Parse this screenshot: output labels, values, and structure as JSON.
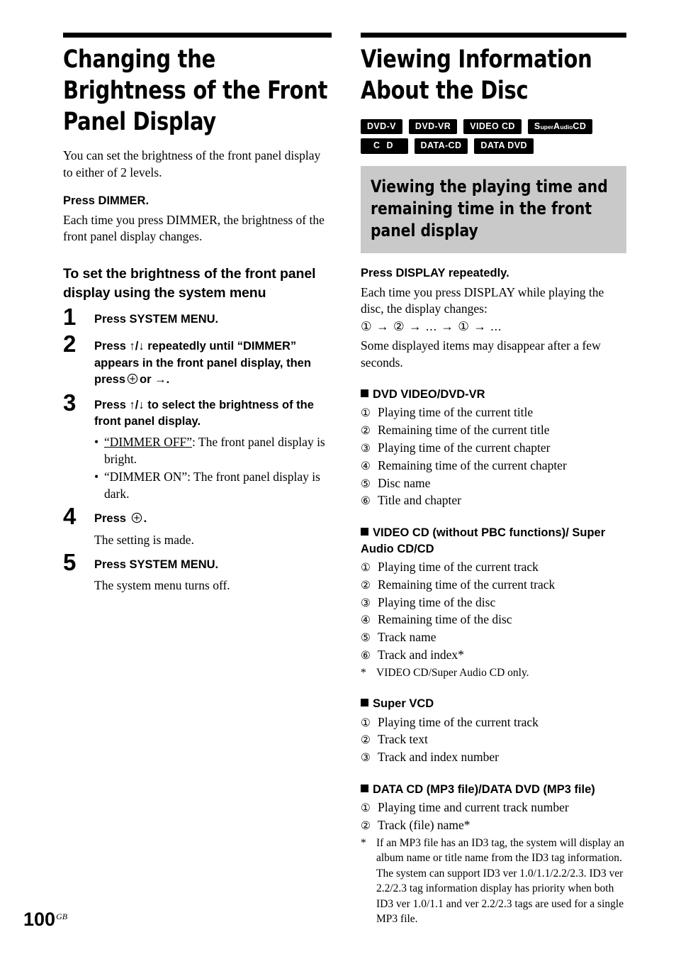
{
  "page": {
    "number": "100",
    "number_suffix": "GB"
  },
  "left_column": {
    "title": "Changing the Brightness of the Front Panel Display",
    "intro": "You can set the brightness of the front panel display to either of 2 levels.",
    "press_dimmer_head": "Press DIMMER.",
    "press_dimmer_body": "Each time you press DIMMER, the brightness of the front panel display changes.",
    "sub_head": "To set the brightness of the front panel display using the system menu",
    "steps": [
      {
        "number": "1",
        "text": "Press SYSTEM MENU."
      },
      {
        "number": "2",
        "text_before_icon": "Press ↑/↓ repeatedly until “DIMMER” appears in the front panel display, then press",
        "icon": "enter-button-icon",
        "text_after_icon": "or →."
      },
      {
        "number": "3",
        "text": "Press ↑/↓ to select the brightness of the front panel display.",
        "bullets": [
          {
            "quoted": "“DIMMER OFF”",
            "underlined": true,
            "rest": ": The front panel display is bright."
          },
          {
            "quoted": "“DIMMER ON”",
            "underlined": false,
            "rest": ": The front panel display is dark."
          }
        ]
      },
      {
        "number": "4",
        "text_before_icon": "Press",
        "icon": "enter-button-icon",
        "text_after_icon": ".",
        "note": "The setting is made."
      },
      {
        "number": "5",
        "text": "Press SYSTEM MENU.",
        "note": "The system menu turns off."
      }
    ]
  },
  "right_column": {
    "title": "Viewing Information About the Disc",
    "badges": [
      {
        "label": "DVD-V",
        "kind": "plain"
      },
      {
        "label": "DVD-VR",
        "kind": "plain"
      },
      {
        "label": "VIDEO CD",
        "kind": "plain"
      },
      {
        "label": "SuperAudioCD",
        "kind": "sacd"
      },
      {
        "label": "C D",
        "kind": "wide"
      },
      {
        "label": "DATA-CD",
        "kind": "plain"
      },
      {
        "label": "DATA DVD",
        "kind": "plain"
      }
    ],
    "gray_heading": "Viewing the playing time and remaining time in the front panel display",
    "press_display_head": "Press DISPLAY repeatedly.",
    "press_display_body": "Each time you press DISPLAY while playing the disc, the display changes:",
    "sequence": "① → ② → ... → ① → ...",
    "sequence_note": "Some displayed items may disappear after a few seconds.",
    "sections": [
      {
        "heading": "DVD VIDEO/DVD-VR",
        "items": [
          {
            "num": "①",
            "text": "Playing time of the current title"
          },
          {
            "num": "②",
            "text": "Remaining time of the current title"
          },
          {
            "num": "③",
            "text": "Playing time of the current chapter"
          },
          {
            "num": "④",
            "text": "Remaining time of the current chapter"
          },
          {
            "num": "⑤",
            "text": "Disc name"
          },
          {
            "num": "⑥",
            "text": "Title and chapter"
          }
        ],
        "footnote": null
      },
      {
        "heading": "VIDEO CD (without PBC functions)/ Super Audio CD/CD",
        "items": [
          {
            "num": "①",
            "text": "Playing time of the current track"
          },
          {
            "num": "②",
            "text": "Remaining time of the current track"
          },
          {
            "num": "③",
            "text": "Playing time of the disc"
          },
          {
            "num": "④",
            "text": "Remaining time of the disc"
          },
          {
            "num": "⑤",
            "text": "Track name"
          },
          {
            "num": "⑥",
            "text": "Track and index*"
          }
        ],
        "footnote": {
          "marker": "*",
          "lines": [
            "VIDEO CD/Super Audio CD only."
          ]
        }
      },
      {
        "heading": "Super VCD",
        "items": [
          {
            "num": "①",
            "text": "Playing time of the current track"
          },
          {
            "num": "②",
            "text": "Track text"
          },
          {
            "num": "③",
            "text": "Track and index number"
          }
        ],
        "footnote": null
      },
      {
        "heading": "DATA CD (MP3 file)/DATA DVD (MP3 file)",
        "items": [
          {
            "num": "①",
            "text": "Playing time and current track number"
          },
          {
            "num": "②",
            "text": "Track (file) name*"
          }
        ],
        "footnote": {
          "marker": "*",
          "lines": [
            "If an MP3 file has an ID3 tag, the system will display an album name or title name from the ID3 tag information.",
            "The system can support ID3 ver 1.0/1.1/2.2/2.3. ID3 ver 2.2/2.3 tag information display has priority when both ID3 ver 1.0/1.1 and ver 2.2/2.3 tags are used for a single MP3 file."
          ]
        }
      }
    ]
  },
  "colors": {
    "gray_block": "#c9c9c9",
    "ink": "#000000",
    "paper": "#ffffff"
  }
}
